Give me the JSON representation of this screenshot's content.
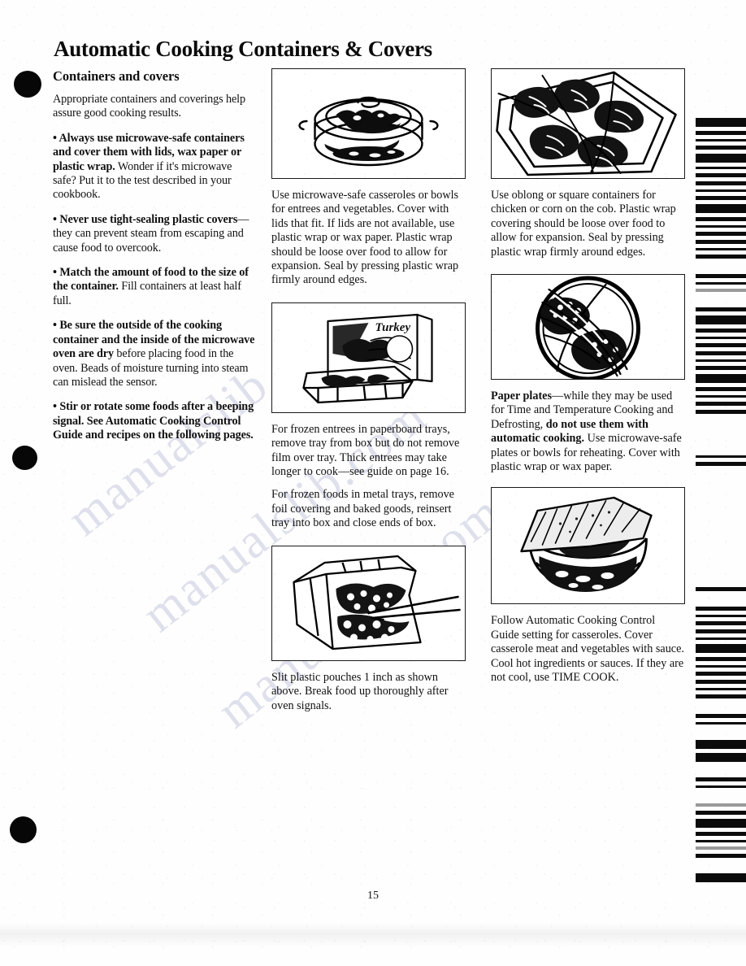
{
  "document": {
    "title": "Automatic Cooking Containers & Covers",
    "page_number": "15",
    "watermark_text": "manualslib.com"
  },
  "left_column": {
    "heading": "Containers and covers",
    "intro": "Appropriate containers and coverings help assure good cooking results.",
    "bullets": [
      {
        "lead": "• Always use microwave-safe containers and cover them with lids, wax paper or plastic wrap.",
        "rest": " Wonder if it's microwave safe? Put it to the test described in your cookbook."
      },
      {
        "lead": "• Never use tight-sealing plastic covers",
        "rest": "—they can prevent steam from escaping and cause food to overcook."
      },
      {
        "lead": "• Match the amount of food to the size of the container.",
        "rest": " Fill containers at least half full."
      },
      {
        "lead": "• Be sure the outside of the cooking container and the inside of the microwave oven are dry",
        "rest": " before placing food in the oven. Beads of moisture turning into steam can mislead the sensor."
      },
      {
        "lead": "• Stir or rotate some foods after a beeping signal. See Automatic Cooking Control Guide and recipes on the following pages.",
        "rest": ""
      }
    ]
  },
  "middle_column": {
    "figures": [
      {
        "name": "covered-casserole-dish",
        "alt": "Covered round casserole dish with lid"
      },
      {
        "name": "frozen-entree-tray",
        "alt": "Frozen turkey dinner box with compartmented tray"
      },
      {
        "name": "plastic-pouch-slit",
        "alt": "Scissors slitting a plastic food pouch"
      }
    ],
    "caption_1": "Use microwave-safe casseroles or bowls for entrees and vegetables. Cover with lids that fit. If lids are not available, use plastic wrap or wax paper. Plastic wrap should be loose over food to allow for expansion. Seal by pressing plastic wrap firmly around edges.",
    "caption_2a": "For frozen entrees in paperboard trays, remove tray from box but do not remove film over tray. Thick entrees may take longer to cook—see guide on page 16.",
    "caption_2b": "For frozen foods in metal trays, remove foil covering and baked goods, reinsert tray into box and close ends of box.",
    "caption_3": "Slit plastic pouches 1 inch as shown above. Break food up thoroughly after oven signals."
  },
  "right_column": {
    "figures": [
      {
        "name": "oblong-dish-chicken",
        "alt": "Chicken pieces in an oblong dish with plastic wrap"
      },
      {
        "name": "round-plate-covered",
        "alt": "Round plate of food covered with plastic wrap"
      },
      {
        "name": "casserole-bowl-waxpaper",
        "alt": "Bowl of casserole covered with wax paper"
      }
    ],
    "caption_1": "Use oblong or square containers for chicken or corn on the cob. Plastic wrap covering should be loose over food to allow for expansion. Seal by pressing plastic wrap firmly around edges.",
    "caption_2": {
      "bold_lead": "Paper plates",
      "mid": "—while they may be used for Time and Temperature Cooking and Defrosting, ",
      "bold_mid": "do not use them with automatic cooking.",
      "rest": " Use microwave-safe plates or bowls for reheating. Cover with plastic wrap or wax paper."
    },
    "caption_3": "Follow Automatic Cooking Control Guide setting for casseroles. Cover casserole meat and vegetables with sauce. Cool hot ingredients or sauces. If they are not cool, use TIME COOK."
  }
}
